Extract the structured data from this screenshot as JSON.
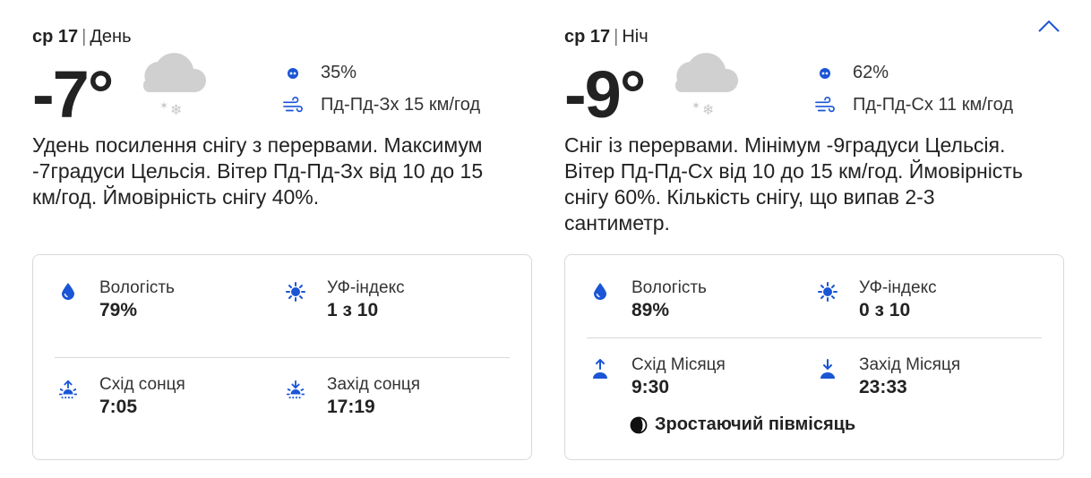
{
  "colors": {
    "accent": "#1a55d6",
    "text": "#222222",
    "border": "#d9d9d9",
    "cloud": "#d0d0d0"
  },
  "day": {
    "date": "ср 17",
    "period": "День",
    "temperature": "-7°",
    "weather_icon": "cloud-snow-icon",
    "precip": "35%",
    "wind": "Пд-Пд-Зх 15 км/год",
    "description": "Удень посилення снігу з перервами. Максимум -7градуси Цельсія. Вітер Пд-Пд-Зх від 10 до 15 км/год. Ймовірність снігу 40%.",
    "humidity_label": "Вологість",
    "humidity_value": "79%",
    "uv_label": "УФ-індекс",
    "uv_value": "1 з 10",
    "rise_label": "Схід сонця",
    "rise_value": "7:05",
    "set_label": "Захід сонця",
    "set_value": "17:19"
  },
  "night": {
    "date": "ср 17",
    "period": "Ніч",
    "temperature": "-9°",
    "weather_icon": "cloud-snow-icon",
    "precip": "62%",
    "wind": "Пд-Пд-Сх 11 км/год",
    "description": "Сніг із перервами. Мінімум -9градуси Цельсія. Вітер Пд-Пд-Сх від 10 до 15 км/год. Ймовірність снігу 60%. Кількість снігу, що випав 2-3 сантиметр.",
    "humidity_label": "Вологість",
    "humidity_value": "89%",
    "uv_label": "УФ-індекс",
    "uv_value": "0 з 10",
    "rise_label": "Схід Місяця",
    "rise_value": "9:30",
    "set_label": "Захід Місяця",
    "set_value": "23:33",
    "moon_phase": "Зростаючий півмісяць"
  }
}
